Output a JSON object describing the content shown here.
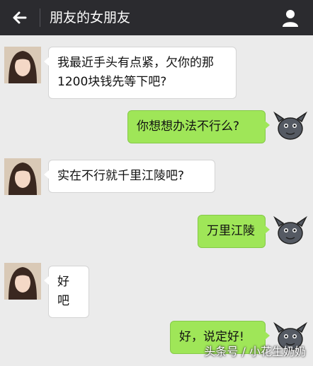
{
  "header": {
    "back_icon": "back-arrow-icon",
    "title": "朋友的女朋友",
    "profile_icon": "person-icon",
    "bg_color": "#2b2b2f"
  },
  "colors": {
    "incoming_bubble": "#ffffff",
    "outgoing_bubble": "#9fe658",
    "chat_background": "#ebebeb"
  },
  "messages": [
    {
      "side": "left",
      "text": "我最近手头有点紧，欠你的那1200块钱先等下吧?"
    },
    {
      "side": "right",
      "text": "你想想办法不行么?"
    },
    {
      "side": "left",
      "text": "实在不行就千里江陵吧?"
    },
    {
      "side": "right",
      "text": "万里江陵"
    },
    {
      "side": "left",
      "text": "好吧"
    },
    {
      "side": "right",
      "text": "好，说定好!"
    }
  ],
  "watermark": "头条号 / 小花生奶奶"
}
